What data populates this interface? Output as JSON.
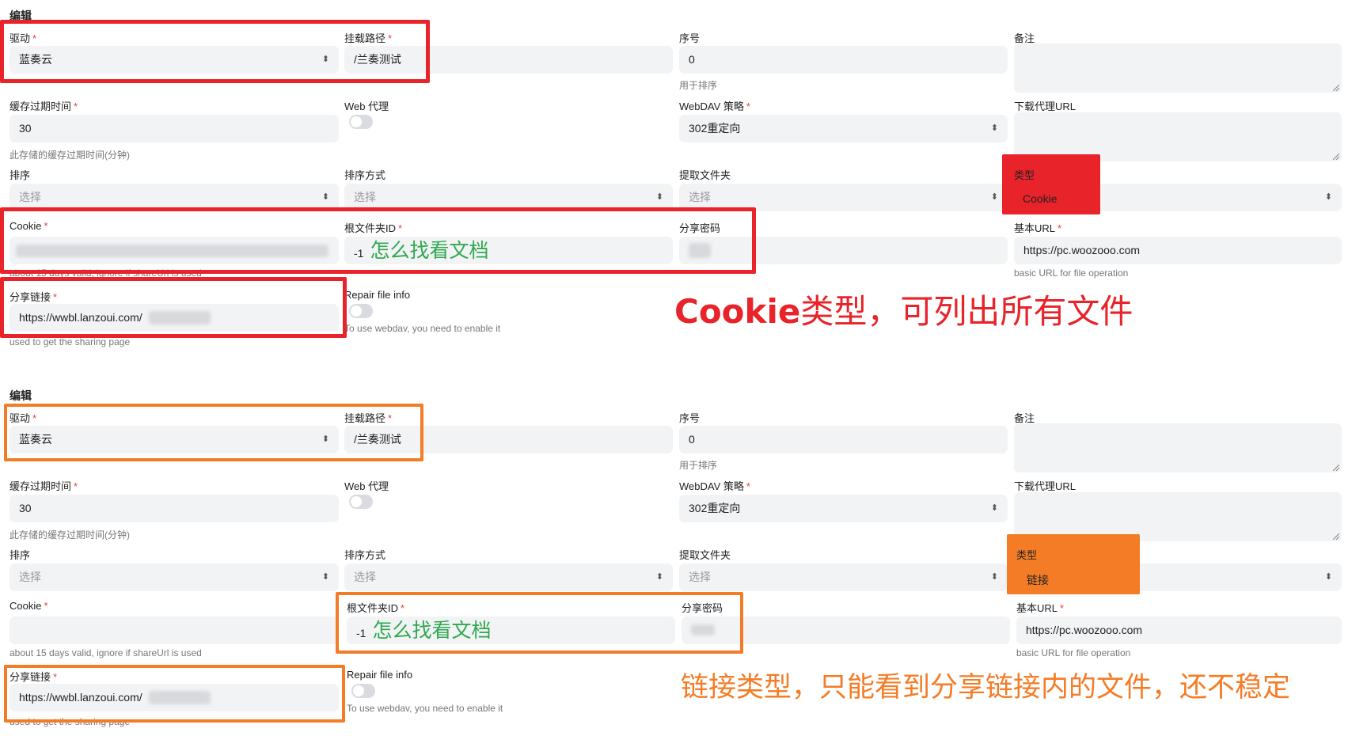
{
  "panel1": {
    "title": "编辑",
    "labels": {
      "driver": "驱动",
      "mount_path": "挂载路径",
      "order": "序号",
      "remark": "备注",
      "cache_expiration": "缓存过期时间",
      "web_proxy": "Web 代理",
      "webdav_policy": "WebDAV 策略",
      "download_proxy_url": "下载代理URL",
      "sort": "排序",
      "sort_direction": "排序方式",
      "extract_folder": "提取文件夹",
      "type": "类型",
      "cookie": "Cookie",
      "root_folder_id": "根文件夹ID",
      "share_password": "分享密码",
      "base_url": "基本URL",
      "share_url": "分享链接",
      "repair_file_info": "Repair file info"
    },
    "values": {
      "driver": "蓝奏云",
      "mount_path": "/兰奏测试",
      "order": "0",
      "cache_expiration": "30",
      "webdav_policy": "302重定向",
      "sort": "选择",
      "sort_direction": "选择",
      "extract_folder": "选择",
      "type": "Cookie",
      "root_folder_id": "-1",
      "base_url": "https://pc.woozooo.com",
      "share_url": "https://wwbl.lanzoui.com/"
    },
    "hints": {
      "order": "用于排序",
      "cache_expiration": "此存储的缓存过期时间(分钟)",
      "cookie": "about 15 days valid, ignore if shareUrl is used",
      "base_url": "basic URL for file operation",
      "share_url": "used to get the sharing page",
      "repair_file_info": "To use webdav, you need to enable it"
    },
    "green_note": "怎么找看文档",
    "annotation": {
      "bold": "Cookie",
      "rest": "类型，可列出所有文件"
    }
  },
  "panel2": {
    "title": "编辑",
    "labels": {
      "driver": "驱动",
      "mount_path": "挂载路径",
      "order": "序号",
      "remark": "备注",
      "cache_expiration": "缓存过期时间",
      "web_proxy": "Web 代理",
      "webdav_policy": "WebDAV 策略",
      "download_proxy_url": "下载代理URL",
      "sort": "排序",
      "sort_direction": "排序方式",
      "extract_folder": "提取文件夹",
      "type": "类型",
      "cookie": "Cookie",
      "root_folder_id": "根文件夹ID",
      "share_password": "分享密码",
      "base_url": "基本URL",
      "share_url": "分享链接",
      "repair_file_info": "Repair file info"
    },
    "values": {
      "driver": "蓝奏云",
      "mount_path": "/兰奏测试",
      "order": "0",
      "cache_expiration": "30",
      "webdav_policy": "302重定向",
      "sort": "选择",
      "sort_direction": "选择",
      "extract_folder": "选择",
      "type": "链接",
      "root_folder_id": "-1",
      "base_url": "https://pc.woozooo.com",
      "share_url": "https://wwbl.lanzoui.com/"
    },
    "hints": {
      "order": "用于排序",
      "cache_expiration": "此存储的缓存过期时间(分钟)",
      "cookie": "about 15 days valid, ignore if shareUrl is used",
      "base_url": "basic URL for file operation",
      "share_url": "used to get the sharing page",
      "repair_file_info": "To use webdav, you need to enable it"
    },
    "green_note": "怎么找看文档",
    "annotation": "链接类型，只能看到分享链接内的文件，还不稳定"
  },
  "colors": {
    "red": "#e8232a",
    "orange": "#f47c26",
    "green": "#2fa84f",
    "required": "#e53e3e",
    "field_bg": "#f2f3f5"
  },
  "icons": {
    "select_arrow": "chevron-up-down-icon",
    "toggle": "toggle-switch",
    "resize": "resize-grip-icon"
  }
}
